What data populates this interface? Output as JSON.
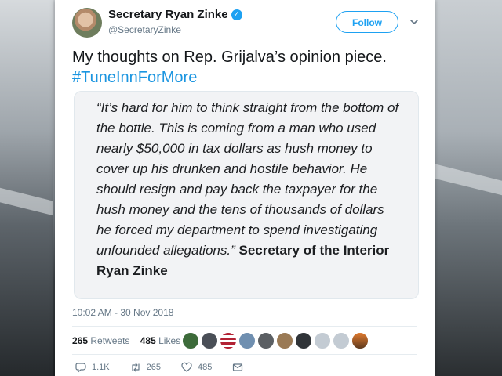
{
  "tweet": {
    "author_name": "Secretary Ryan Zinke",
    "handle": "@SecretaryZinke",
    "follow_label": "Follow",
    "text": "My thoughts on Rep. Grijalva’s opinion piece.",
    "hashtag": "#TuneInnForMore",
    "quote": "“It’s hard for him to think straight from the bottom of the bottle. This is coming from a man who used nearly $50,000 in tax dollars as hush money to cover up his drunken and hostile behavior. He should resign and pay back the taxpayer for the hush money and the tens of thousands of dollars he forced my department to spend investigating unfounded allegations.”",
    "quote_author": "Secretary of the Interior Ryan Zinke",
    "timestamp": "10:02 AM - 30 Nov 2018",
    "retweets": {
      "count": "265",
      "label": "Retweets"
    },
    "likes": {
      "count": "485",
      "label": "Likes"
    },
    "actions": {
      "replies": "1.1K",
      "retweets": "265",
      "likes": "485"
    }
  },
  "icons": {
    "verified": "verified-badge-icon",
    "chevron": "chevron-down-icon",
    "reply": "reply-icon",
    "retweet": "retweet-icon",
    "like": "heart-icon",
    "message": "envelope-icon"
  },
  "colors": {
    "accent": "#1da1f2",
    "hashtag": "#1b95e0",
    "muted": "#657786",
    "text": "#14171a"
  }
}
